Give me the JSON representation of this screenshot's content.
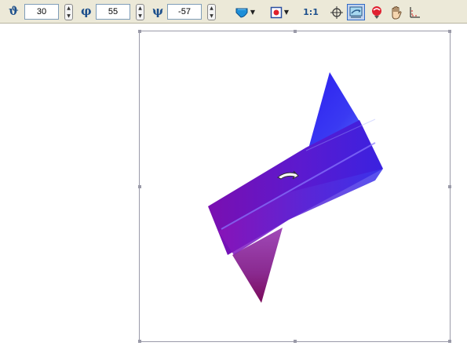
{
  "toolbar": {
    "theta": {
      "icon": "theta-icon",
      "value": "30"
    },
    "phi": {
      "icon": "phi-icon",
      "value": "55"
    },
    "psi": {
      "icon": "psi-icon",
      "value": "-57"
    },
    "scale_label": "1:1",
    "tools": [
      "fill-color-icon",
      "render-mode-icon",
      "reset-view-icon",
      "rotate-view-icon",
      "color-picker-icon",
      "pan-hand-icon",
      "axes-icon"
    ],
    "selected_tool": "rotate-view-icon"
  },
  "viewport": {
    "object": "3d-surface",
    "colors": {
      "violet": "#7a10b8",
      "blue": "#3a2cf0",
      "magenta": "#8e1a78"
    }
  }
}
